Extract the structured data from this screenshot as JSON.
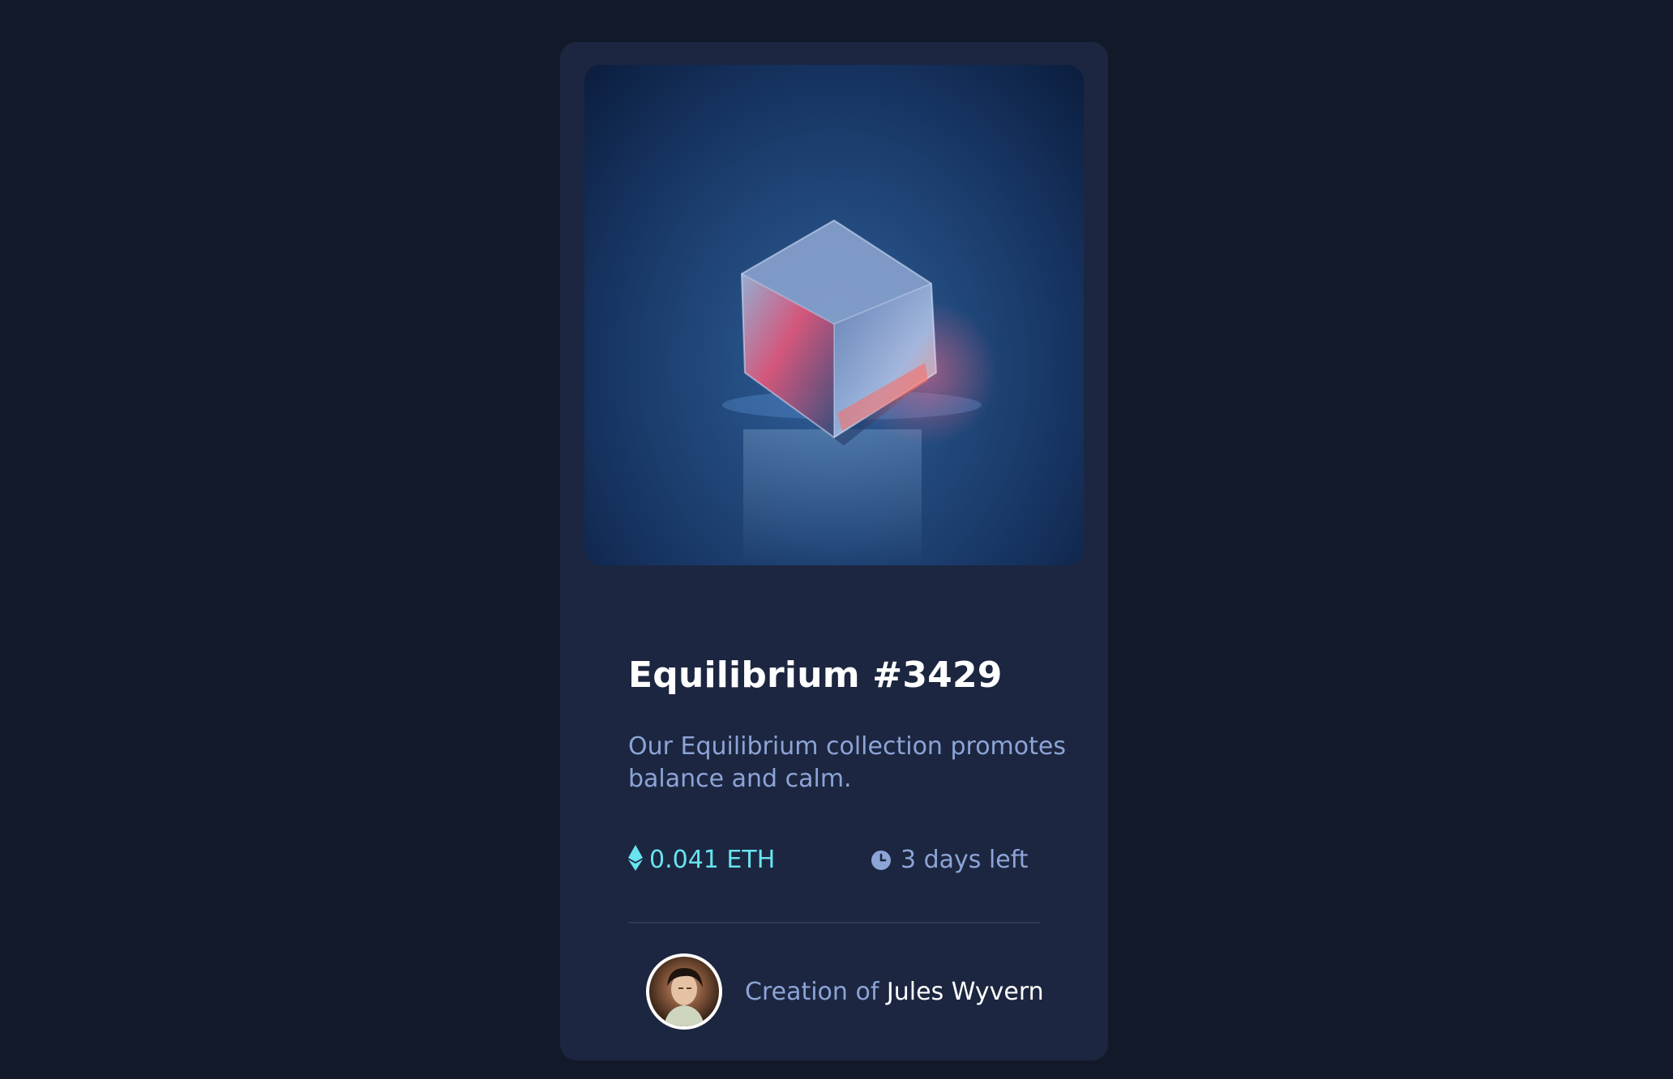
{
  "card": {
    "image_alt": "equilibrium-cube-image",
    "title": "Equilibrium #3429",
    "description": "Our Equilibrium collection promotes balance and calm.",
    "price": "0.041 ETH",
    "time_left": "3 days left",
    "creator_prefix": "Creation of ",
    "creator_name": "Jules Wyvern"
  },
  "colors": {
    "page_background": "#121a2a",
    "card_background": "#1c2640",
    "accent_cyan": "#68e3f0",
    "muted_text": "#8ca4d6",
    "white": "#ffffff",
    "divider": "#2e3a57"
  },
  "icons": {
    "price_icon": "ethereum-icon",
    "time_icon": "clock-icon"
  }
}
